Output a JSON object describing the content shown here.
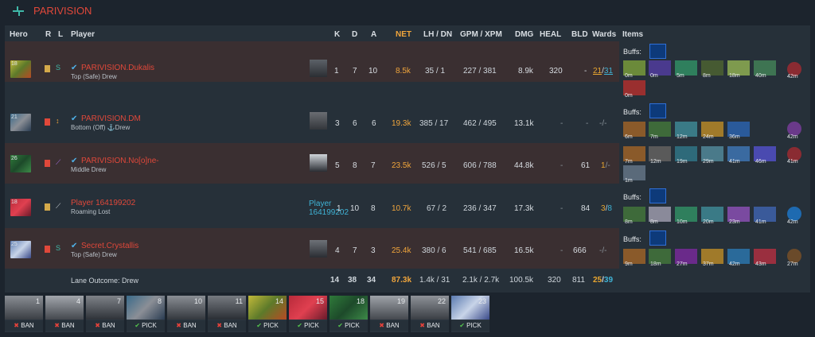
{
  "team": {
    "name": "PARIVISION",
    "accent": "#e0483a",
    "logo_icon": "team-logo-icon"
  },
  "columns": {
    "hero": "Hero",
    "r": "R",
    "l": "L",
    "player": "Player",
    "k": "K",
    "d": "D",
    "a": "A",
    "net": "NET",
    "lhdn": "LH / DN",
    "gpmxpm": "GPM / XPM",
    "dmg": "DMG",
    "heal": "HEAL",
    "bld": "BLD",
    "wards": "Wards",
    "items": "Items"
  },
  "players": [
    {
      "level": "18",
      "name": "PARIVISION.Dukalis",
      "sub": "Top (Safe) Drew",
      "k": "1",
      "d": "7",
      "a": "10",
      "net": "8.5k",
      "lh": "35",
      "dn": "1",
      "gpm": "227",
      "xpm": "381",
      "dmg": "8.9k",
      "heal": "320",
      "bld": "-",
      "wards_obs": "21",
      "wards_sen": "31",
      "buffs_label": "Buffs:",
      "item_times": [
        "0m",
        "0m",
        "5m",
        "8m",
        "18m",
        "40m"
      ],
      "item_times2": [
        "0m"
      ],
      "neutral_time": "42m"
    },
    {
      "level": "21",
      "name": "PARIVISION.DM",
      "sub": "Bottom (Off) ⚓Drew",
      "k": "3",
      "d": "6",
      "a": "6",
      "net": "19.3k",
      "lh": "385",
      "dn": "17",
      "gpm": "462",
      "xpm": "495",
      "dmg": "13.1k",
      "heal": "-",
      "bld": "-",
      "wards_text": "-/-",
      "buffs_label": "Buffs:",
      "item_times": [
        "6m",
        "7m",
        "12m",
        "24m",
        "36m"
      ],
      "neutral_time": "42m"
    },
    {
      "level": "26",
      "name": "PARIVISION.No[o]ne-",
      "sub": "Middle Drew",
      "k": "5",
      "d": "8",
      "a": "7",
      "net": "23.5k",
      "lh": "526",
      "dn": "5",
      "gpm": "606",
      "xpm": "788",
      "dmg": "44.8k",
      "heal": "-",
      "bld": "61",
      "wards_obs": "1",
      "wards_text": "/-",
      "item_times": [
        "7m",
        "12m",
        "19m",
        "29m",
        "41m",
        "46m"
      ],
      "item_times2": [
        "1m"
      ],
      "neutral_time": "41m"
    },
    {
      "level": "18",
      "name": "Player 164199202",
      "sub": "Roaming Lost",
      "portrait_label": "Player 164199202",
      "k": "1",
      "d": "10",
      "a": "8",
      "net": "10.7k",
      "lh": "67",
      "dn": "2",
      "gpm": "236",
      "xpm": "347",
      "dmg": "17.3k",
      "heal": "-",
      "bld": "84",
      "wards_obs": "3",
      "wards_sen": "8",
      "buffs_label": "Buffs:",
      "item_times": [
        "8m",
        "8m",
        "10m",
        "20m",
        "23m",
        "41m"
      ],
      "neutral_time": "42m"
    },
    {
      "level": "25",
      "name": "Secret.Crystallis",
      "sub": "Top (Safe) Drew",
      "k": "4",
      "d": "7",
      "a": "3",
      "net": "25.4k",
      "lh": "380",
      "dn": "6",
      "gpm": "541",
      "xpm": "685",
      "dmg": "16.5k",
      "heal": "-",
      "bld": "666",
      "wards_text": "-/-",
      "buffs_label": "Buffs:",
      "item_times": [
        "9m",
        "18m",
        "27m",
        "37m",
        "42m",
        "43m"
      ],
      "neutral_time": "27m"
    }
  ],
  "totals": {
    "lane_outcome": "Lane Outcome: Drew",
    "k": "14",
    "d": "38",
    "a": "34",
    "net": "87.3k",
    "lhdn": "1.4k / 31",
    "gpmxpm": "2.1k / 2.7k",
    "dmg": "100.5k",
    "heal": "320",
    "bld": "811",
    "wards_obs": "25",
    "wards_sen": "39"
  },
  "draft": [
    {
      "num": "1",
      "type": "BAN"
    },
    {
      "num": "4",
      "type": "BAN"
    },
    {
      "num": "7",
      "type": "BAN"
    },
    {
      "num": "8",
      "type": "PICK"
    },
    {
      "num": "10",
      "type": "BAN"
    },
    {
      "num": "11",
      "type": "BAN"
    },
    {
      "num": "14",
      "type": "PICK"
    },
    {
      "num": "15",
      "type": "PICK"
    },
    {
      "num": "18",
      "type": "PICK"
    },
    {
      "num": "19",
      "type": "BAN"
    },
    {
      "num": "22",
      "type": "BAN"
    },
    {
      "num": "23",
      "type": "PICK"
    }
  ],
  "colors": {
    "net": "#f0a53c",
    "ban": "#e5423b",
    "pick": "#53c24c",
    "wards_obs": "#e8a630",
    "wards_sen": "#3fb3d6",
    "check": "#4fb1e8"
  },
  "icons": {
    "verified": "✔",
    "ban": "✖",
    "pick": "✔"
  }
}
